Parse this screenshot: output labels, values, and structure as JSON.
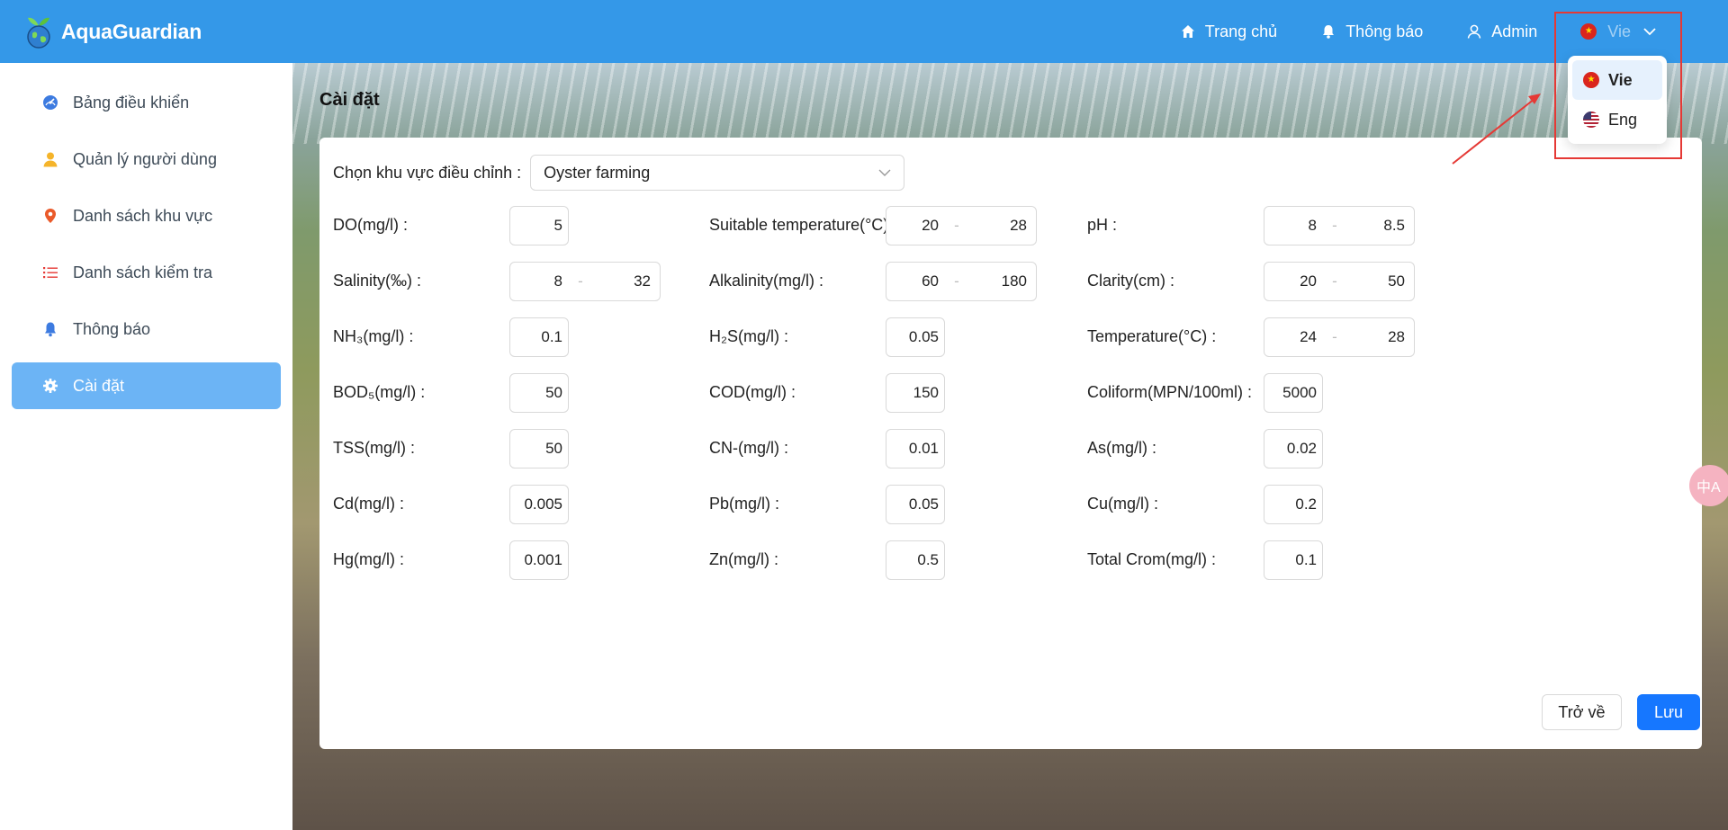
{
  "app": {
    "name": "AquaGuardian"
  },
  "header": {
    "nav": [
      {
        "label": "Trang chủ",
        "icon": "home-icon"
      },
      {
        "label": "Thông báo",
        "icon": "bell-icon"
      },
      {
        "label": "Admin",
        "icon": "user-icon"
      }
    ],
    "language": {
      "current": "Vie",
      "options": [
        "Vie",
        "Eng"
      ]
    }
  },
  "sidebar": {
    "items": [
      {
        "label": "Bảng điều khiển",
        "icon": "dashboard-icon",
        "active": false
      },
      {
        "label": "Quản lý người dùng",
        "icon": "user-icon",
        "active": false
      },
      {
        "label": "Danh sách khu vực",
        "icon": "location-pin-icon",
        "active": false
      },
      {
        "label": "Danh sách kiểm tra",
        "icon": "list-icon",
        "active": false
      },
      {
        "label": "Thông báo",
        "icon": "bell-icon",
        "active": false
      },
      {
        "label": "Cài đặt",
        "icon": "gear-icon",
        "active": true
      }
    ]
  },
  "page": {
    "title": "Cài đặt",
    "zone_label": "Chọn khu vực điều chỉnh :",
    "zone_value": "Oyster farming",
    "params": [
      [
        {
          "label": "DO(mg/l) :",
          "value": "5"
        },
        {
          "label": "Suitable temperature(°C) :",
          "min": "20",
          "max": "28"
        },
        {
          "label": "pH :",
          "min": "8",
          "max": "8.5"
        }
      ],
      [
        {
          "label": "Salinity(‰) :",
          "min": "8",
          "max": "32"
        },
        {
          "label": "Alkalinity(mg/l) :",
          "min": "60",
          "max": "180"
        },
        {
          "label": "Clarity(cm) :",
          "min": "20",
          "max": "50"
        }
      ],
      [
        {
          "label": "NH₃(mg/l) :",
          "value": "0.1"
        },
        {
          "label": "H₂S(mg/l) :",
          "value": "0.05"
        },
        {
          "label": "Temperature(°C) :",
          "min": "24",
          "max": "28"
        }
      ],
      [
        {
          "label": "BOD₅(mg/l) :",
          "value": "50"
        },
        {
          "label": "COD(mg/l) :",
          "value": "150"
        },
        {
          "label": "Coliform(MPN/100ml) :",
          "value": "5000"
        }
      ],
      [
        {
          "label": "TSS(mg/l) :",
          "value": "50"
        },
        {
          "label": "CN-(mg/l) :",
          "value": "0.01"
        },
        {
          "label": "As(mg/l) :",
          "value": "0.02"
        }
      ],
      [
        {
          "label": "Cd(mg/l) :",
          "value": "0.005"
        },
        {
          "label": "Pb(mg/l) :",
          "value": "0.05"
        },
        {
          "label": "Cu(mg/l) :",
          "value": "0.2"
        }
      ],
      [
        {
          "label": "Hg(mg/l) :",
          "value": "0.001"
        },
        {
          "label": "Zn(mg/l) :",
          "value": "0.5"
        },
        {
          "label": "Total Crom(mg/l) :",
          "value": "0.1"
        }
      ]
    ],
    "range_separator": "-",
    "buttons": {
      "back": "Trở về",
      "save": "Lưu"
    }
  },
  "float_widget": {
    "label": "中A"
  },
  "colors": {
    "header": "#3498e8",
    "active_sidebar": "#6cb4f5",
    "primary_button": "#1677ff",
    "highlight": "#e53935"
  }
}
